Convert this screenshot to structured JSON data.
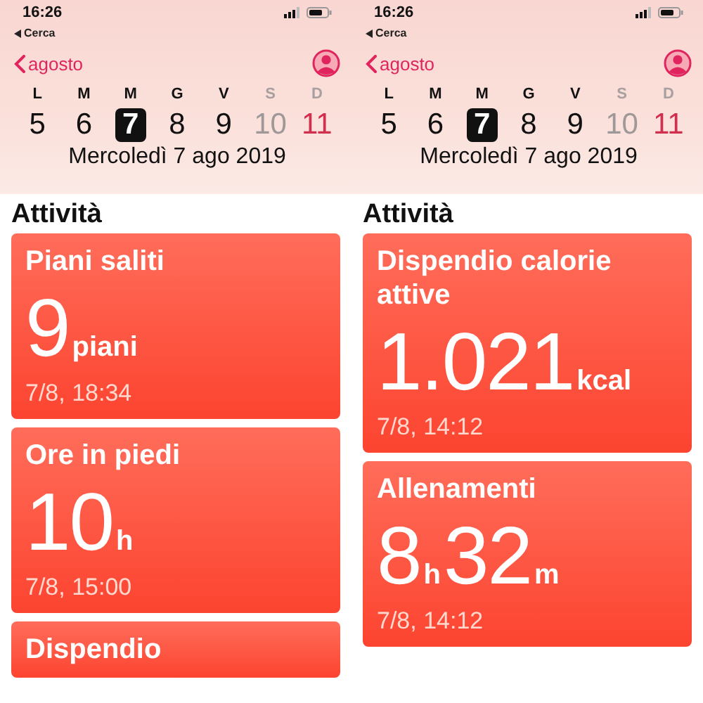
{
  "panels": [
    {
      "status_bar": {
        "time": "16:26",
        "back": "Cerca"
      },
      "nav": {
        "month": "agosto"
      },
      "weekdays": [
        {
          "letter": "L",
          "kind": "weekday"
        },
        {
          "letter": "M",
          "kind": "weekday"
        },
        {
          "letter": "M",
          "kind": "weekday"
        },
        {
          "letter": "G",
          "kind": "weekday"
        },
        {
          "letter": "V",
          "kind": "weekday"
        },
        {
          "letter": "S",
          "kind": "saturday"
        },
        {
          "letter": "D",
          "kind": "sunday"
        }
      ],
      "days": [
        {
          "label": "5",
          "kind": "weekday",
          "selected": false
        },
        {
          "label": "6",
          "kind": "weekday",
          "selected": false
        },
        {
          "label": "7",
          "kind": "weekday",
          "selected": true
        },
        {
          "label": "8",
          "kind": "weekday",
          "selected": false
        },
        {
          "label": "9",
          "kind": "weekday",
          "selected": false
        },
        {
          "label": "10",
          "kind": "saturday",
          "selected": false
        },
        {
          "label": "11",
          "kind": "sunday",
          "selected": false
        }
      ],
      "date_title": "Mercoledì 7 ago 2019",
      "section": "Attività",
      "cards": [
        {
          "title": "Piani saliti",
          "value": [
            {
              "number": "9",
              "unit": "piani"
            }
          ],
          "date": "7/8, 18:34"
        },
        {
          "title": "Ore in piedi",
          "value": [
            {
              "number": "10",
              "unit": "h"
            }
          ],
          "date": "7/8, 15:00"
        },
        {
          "title": "Dispendio"
        }
      ]
    },
    {
      "status_bar": {
        "time": "16:26",
        "back": "Cerca"
      },
      "nav": {
        "month": "agosto"
      },
      "weekdays": [
        {
          "letter": "L",
          "kind": "weekday"
        },
        {
          "letter": "M",
          "kind": "weekday"
        },
        {
          "letter": "M",
          "kind": "weekday"
        },
        {
          "letter": "G",
          "kind": "weekday"
        },
        {
          "letter": "V",
          "kind": "weekday"
        },
        {
          "letter": "S",
          "kind": "saturday"
        },
        {
          "letter": "D",
          "kind": "sunday"
        }
      ],
      "days": [
        {
          "label": "5",
          "kind": "weekday",
          "selected": false
        },
        {
          "label": "6",
          "kind": "weekday",
          "selected": false
        },
        {
          "label": "7",
          "kind": "weekday",
          "selected": true
        },
        {
          "label": "8",
          "kind": "weekday",
          "selected": false
        },
        {
          "label": "9",
          "kind": "weekday",
          "selected": false
        },
        {
          "label": "10",
          "kind": "saturday",
          "selected": false
        },
        {
          "label": "11",
          "kind": "sunday",
          "selected": false
        }
      ],
      "date_title": "Mercoledì 7 ago 2019",
      "section": "Attività",
      "cards": [
        {
          "title": "Dispendio calorie attive",
          "value": [
            {
              "number": "1.021",
              "unit": "kcal"
            }
          ],
          "date": "7/8, 14:12"
        },
        {
          "title": "Allenamenti",
          "value": [
            {
              "number": "8",
              "unit": "h"
            },
            {
              "number": "32",
              "unit": "m"
            }
          ],
          "date": "7/8, 14:12"
        }
      ]
    }
  ]
}
